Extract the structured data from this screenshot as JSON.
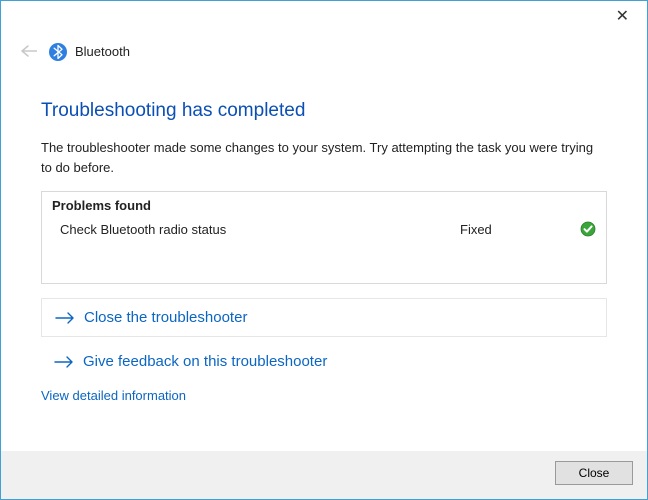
{
  "header": {
    "title": "Bluetooth"
  },
  "main": {
    "heading": "Troubleshooting has completed",
    "description": "The troubleshooter made some changes to your system. Try attempting the task you were trying to do before."
  },
  "problems": {
    "heading": "Problems found",
    "rows": [
      {
        "name": "Check Bluetooth radio status",
        "status": "Fixed"
      }
    ]
  },
  "actions": {
    "close_troubleshooter": "Close the troubleshooter",
    "give_feedback": "Give feedback on this troubleshooter",
    "view_detailed": "View detailed information"
  },
  "footer": {
    "close_label": "Close"
  }
}
